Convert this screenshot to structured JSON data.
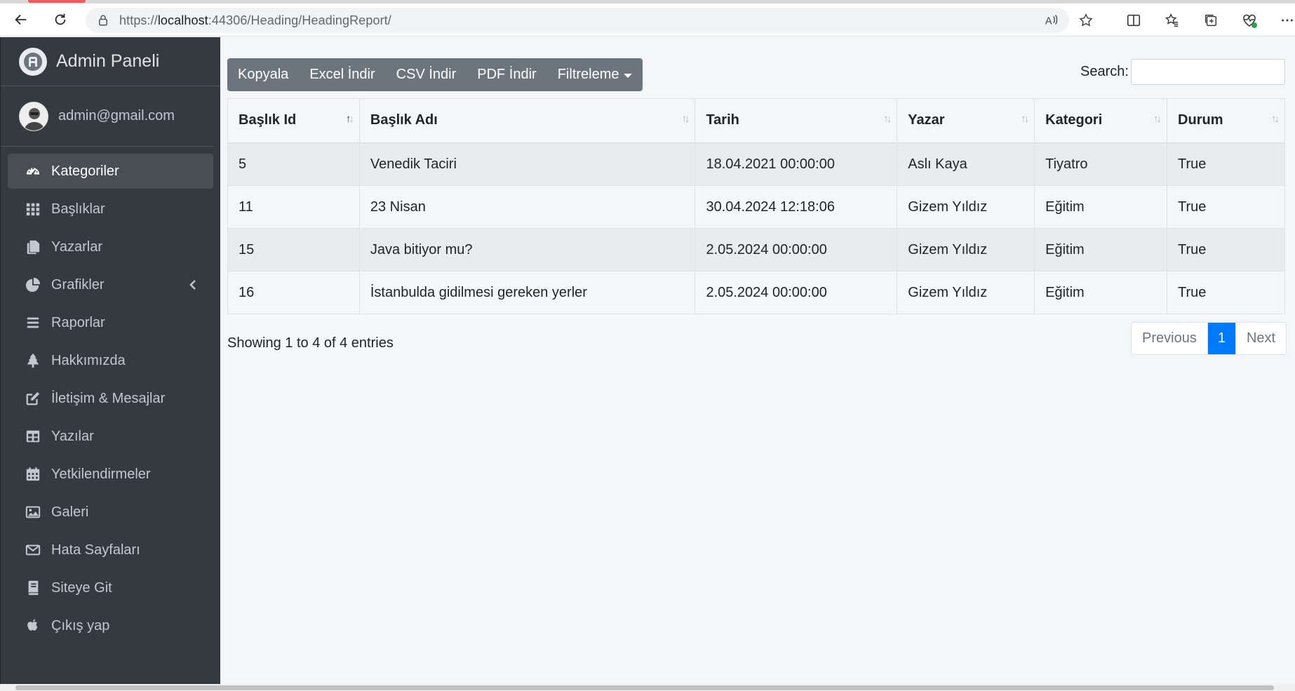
{
  "browser": {
    "url_prefix": "https://",
    "url_host": "localhost",
    "url_rest": ":44306/Heading/HeadingReport/"
  },
  "sidebar": {
    "brand": "Admin Paneli",
    "user": "admin@gmail.com",
    "items": [
      {
        "label": "Kategoriler",
        "icon": "tachometer-icon",
        "active": true
      },
      {
        "label": "Başlıklar",
        "icon": "grid-icon"
      },
      {
        "label": "Yazarlar",
        "icon": "copy-icon"
      },
      {
        "label": "Grafikler",
        "icon": "pie-chart-icon",
        "has_chevron": true
      },
      {
        "label": "Raporlar",
        "icon": "bars-icon"
      },
      {
        "label": "Hakkımızda",
        "icon": "tree-icon"
      },
      {
        "label": "İletişim & Mesajlar",
        "icon": "edit-icon"
      },
      {
        "label": "Yazılar",
        "icon": "table-icon"
      },
      {
        "label": "Yetkilendirmeler",
        "icon": "calendar-icon"
      },
      {
        "label": "Galeri",
        "icon": "image-icon"
      },
      {
        "label": "Hata Sayfaları",
        "icon": "envelope-icon"
      },
      {
        "label": "Siteye Git",
        "icon": "book-icon"
      },
      {
        "label": "Çıkış yap",
        "icon": "apple-icon"
      }
    ]
  },
  "toolbar": {
    "copy": "Kopyala",
    "excel": "Excel İndir",
    "csv": "CSV İndir",
    "pdf": "PDF İndir",
    "filter": "Filtreleme"
  },
  "search": {
    "label": "Search:",
    "value": ""
  },
  "table": {
    "columns": [
      "Başlık Id",
      "Başlık Adı",
      "Tarih",
      "Yazar",
      "Kategori",
      "Durum"
    ],
    "rows": [
      [
        "5",
        "Venedik Taciri",
        "18.04.2021 00:00:00",
        "Aslı Kaya",
        "Tiyatro",
        "True"
      ],
      [
        "11",
        "23 Nisan",
        "30.04.2024 12:18:06",
        "Gizem Yıldız",
        "Eğitim",
        "True"
      ],
      [
        "15",
        "Java bitiyor mu?",
        "2.05.2024 00:00:00",
        "Gizem Yıldız",
        "Eğitim",
        "True"
      ],
      [
        "16",
        "İstanbulda gidilmesi gereken yerler",
        "2.05.2024 00:00:00",
        "Gizem Yıldız",
        "Eğitim",
        "True"
      ]
    ]
  },
  "info": "Showing 1 to 4 of 4 entries",
  "pagination": {
    "previous": "Previous",
    "current": "1",
    "next": "Next"
  },
  "colors": {
    "sidebar": "#343a40",
    "toolbar": "#6c757d",
    "primary": "#007bff"
  }
}
